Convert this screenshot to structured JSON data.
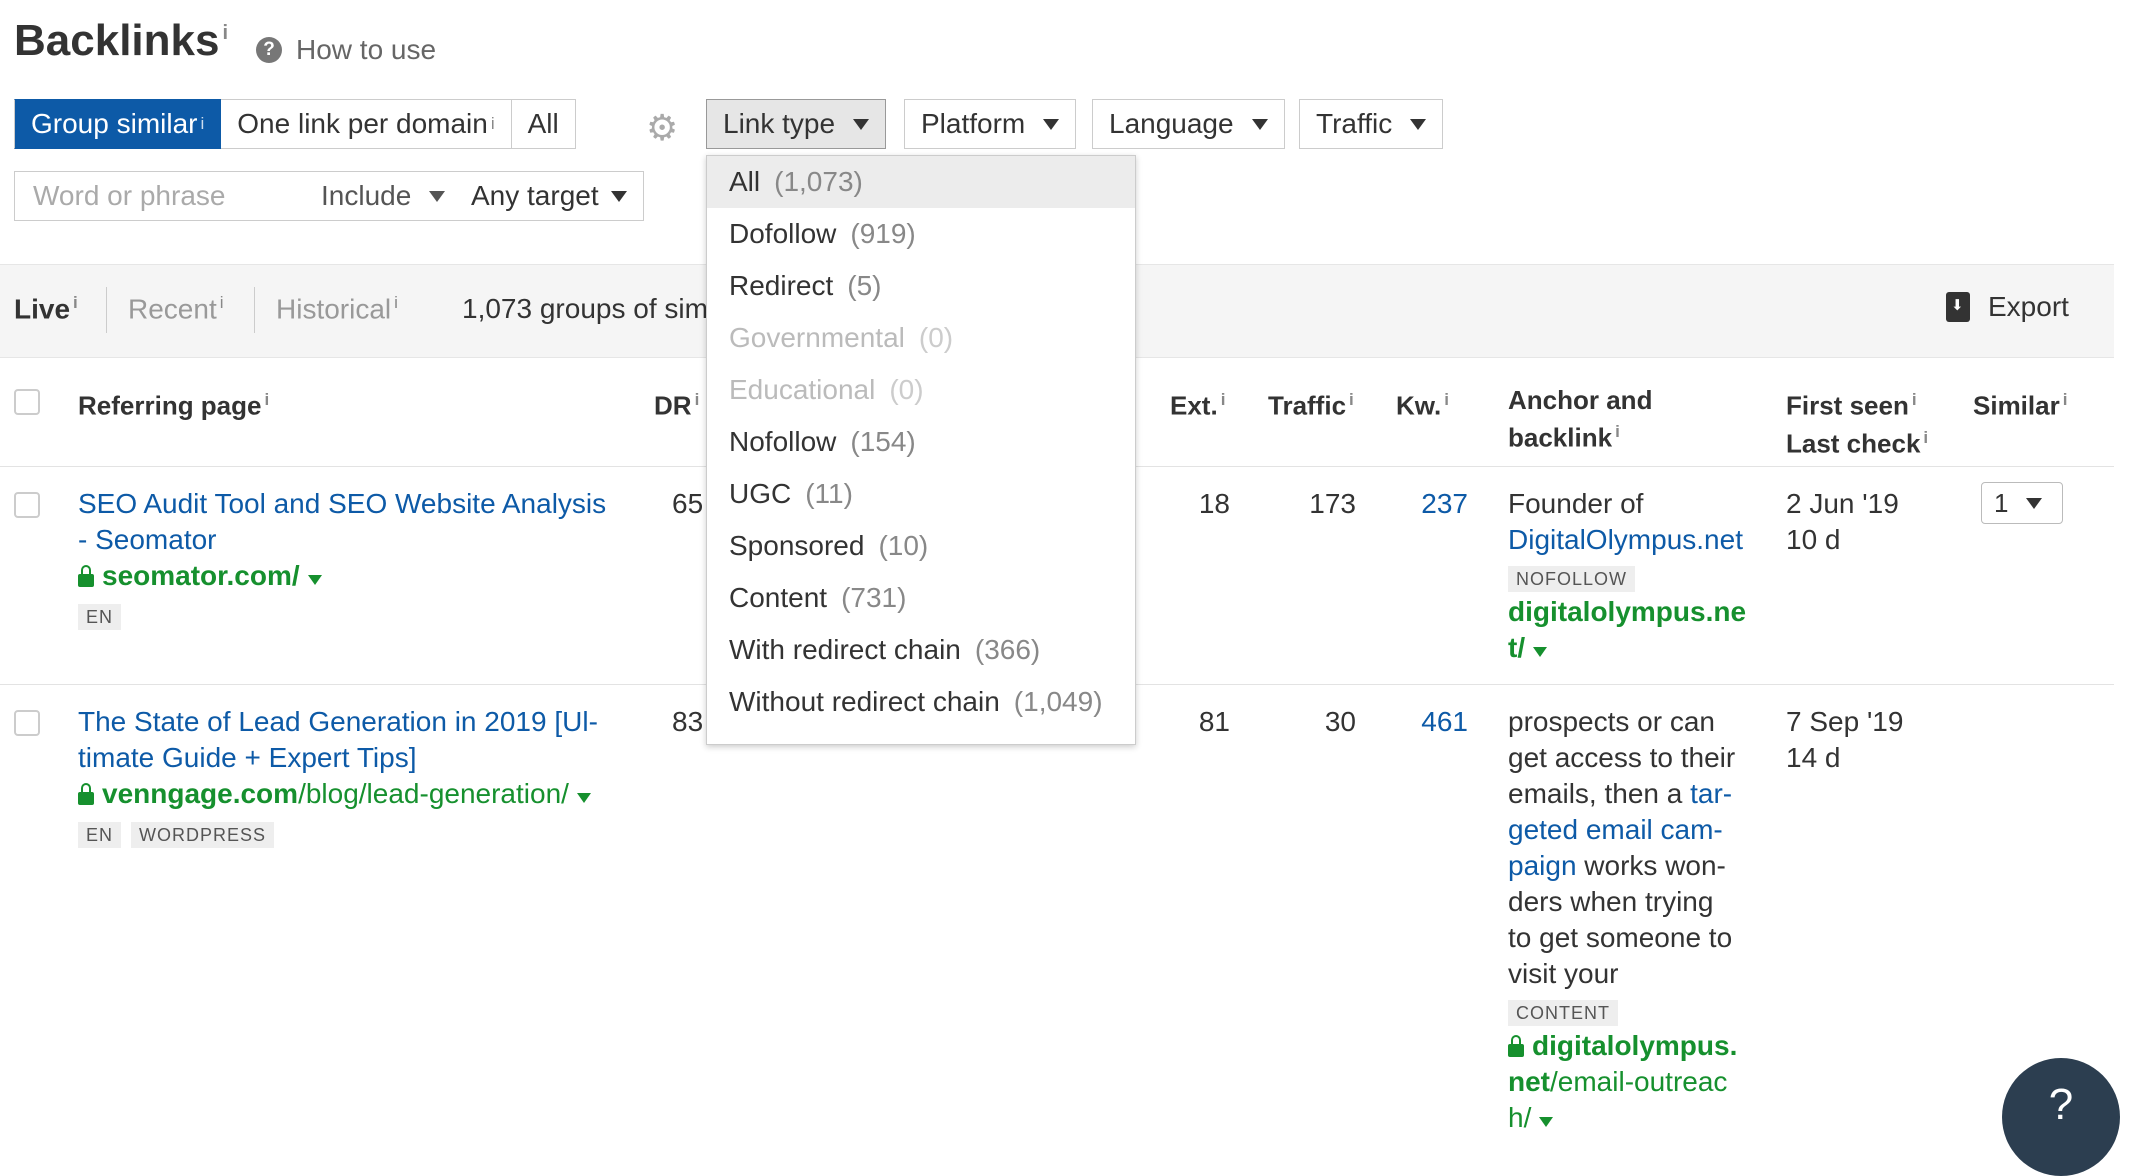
{
  "header": {
    "title": "Backlinks",
    "title_info": "i",
    "how_to_use": "How to use",
    "help_glyph": "?"
  },
  "group_mode": {
    "options": [
      {
        "label": "Group similar",
        "info": "i",
        "active": true
      },
      {
        "label": "One link per domain",
        "info": "i",
        "active": false
      },
      {
        "label": "All",
        "info": "",
        "active": false
      }
    ]
  },
  "filters": {
    "link_type": "Link type",
    "platform": "Platform",
    "language": "Language",
    "traffic": "Traffic"
  },
  "search": {
    "placeholder": "Word or phrase",
    "mode": "Include",
    "target": "Any target"
  },
  "history_tabs": {
    "live": "Live",
    "recent": "Recent",
    "historical": "Historical",
    "info": "i",
    "groups_summary": "1,073 groups of sim",
    "export": "Export"
  },
  "table": {
    "headers": {
      "referring_page": "Referring page",
      "dr": "DR",
      "ext": "Ext.",
      "traffic": "Traffic",
      "kw": "Kw.",
      "anchor_line1": "Anchor and",
      "anchor_line2": "backlink",
      "first_seen": "First seen",
      "last_check": "Last check",
      "similar": "Similar",
      "info": "i"
    },
    "rows": [
      {
        "title_line1": "SEO Audit Tool and SEO Website Analysis",
        "title_line2": "- Seomator",
        "domain": "seomator.com/",
        "path": "",
        "tags": [
          "EN"
        ],
        "dr": "65",
        "ext": "18",
        "traffic": "173",
        "kw": "237",
        "anchor_text_1": "Founder of",
        "anchor_link": "DigitalOlympus.net",
        "anchor_tag": "NOFOLLOW",
        "backlink_line1": "digitalolympus.ne",
        "backlink_line2": "t/",
        "first_seen": "2 Jun '19",
        "last_check": "10 d",
        "similar": "1"
      },
      {
        "title_line1": "The State of Lead Generation in 2019 [Ul-",
        "title_line2": "timate Guide + Expert Tips]",
        "domain": "venngage.com",
        "path": "/blog/lead-generation/",
        "tags": [
          "EN",
          "WORDPRESS"
        ],
        "dr": "83",
        "ext": "81",
        "traffic": "30",
        "kw": "461",
        "anchor_lines": [
          "prospects or can",
          "get access to their",
          "emails, then a "
        ],
        "anchor_link_parts": [
          "tar-",
          "geted email cam-",
          "paign"
        ],
        "anchor_tail_lines": [
          " works won-",
          "ders when trying",
          "to get someone to",
          "visit your"
        ],
        "anchor_tag": "CONTENT",
        "backlink_line1": "digitalolympus.",
        "backlink_line2_domain": "net",
        "backlink_line2_path": "/email-outreac",
        "backlink_line3": "h/",
        "first_seen": "7 Sep '19",
        "last_check": "14 d"
      }
    ]
  },
  "link_type_dropdown": {
    "items": [
      {
        "label": "All",
        "count": "(1,073)",
        "state": "hover"
      },
      {
        "label": "Dofollow",
        "count": "(919)",
        "state": ""
      },
      {
        "label": "Redirect",
        "count": "(5)",
        "state": ""
      },
      {
        "label": "Governmental",
        "count": "(0)",
        "state": "disabled"
      },
      {
        "label": "Educational",
        "count": "(0)",
        "state": "disabled"
      },
      {
        "label": "Nofollow",
        "count": "(154)",
        "state": ""
      },
      {
        "label": "UGC",
        "count": "(11)",
        "state": ""
      },
      {
        "label": "Sponsored",
        "count": "(10)",
        "state": ""
      },
      {
        "label": "Content",
        "count": "(731)",
        "state": ""
      },
      {
        "label": "With redirect chain",
        "count": "(366)",
        "state": ""
      },
      {
        "label": "Without redirect chain",
        "count": "(1,049)",
        "state": ""
      }
    ]
  },
  "colors": {
    "accent": "#0d5aa7",
    "link": "#0d5aa7",
    "domain_green": "#16902e",
    "help_button": "#2c3e50"
  }
}
